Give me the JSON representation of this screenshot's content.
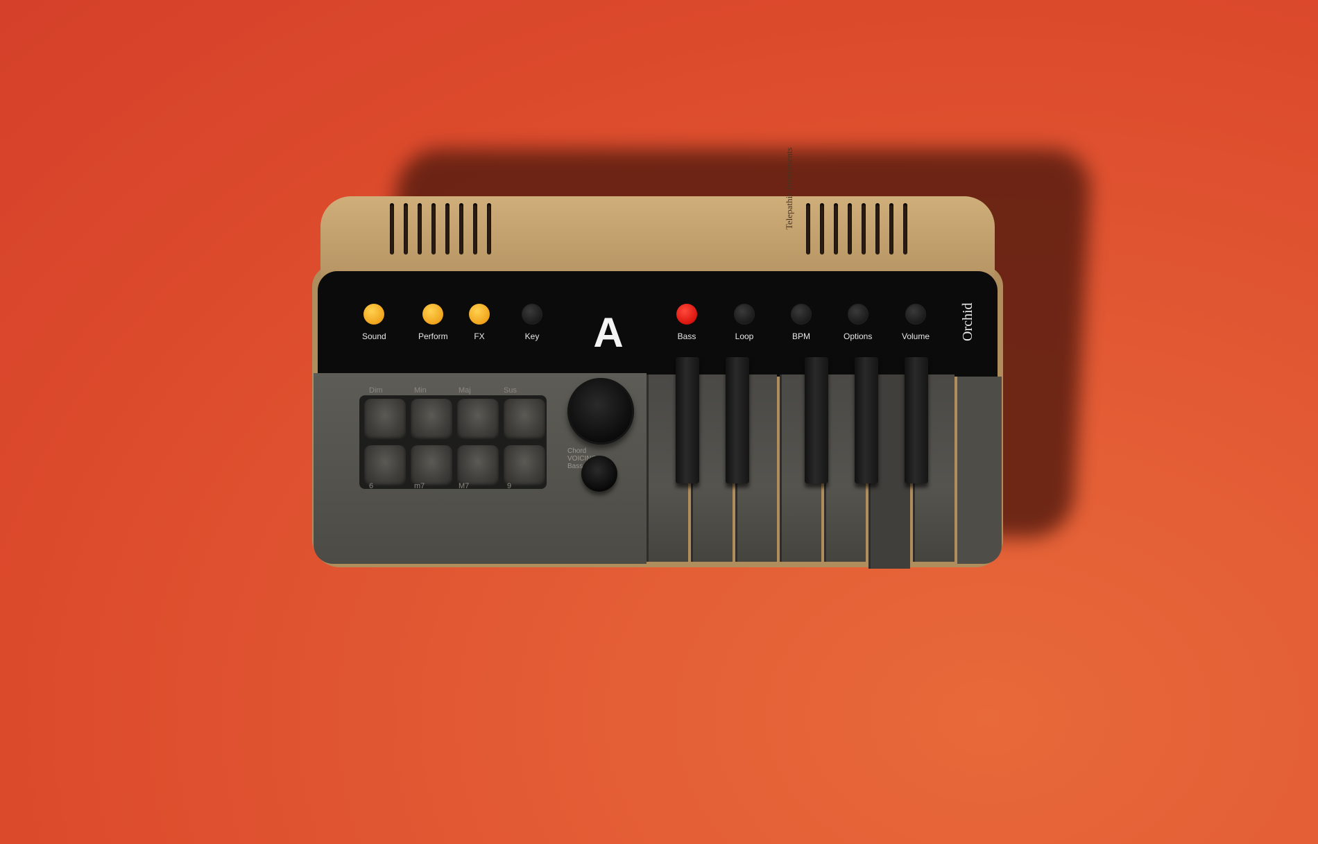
{
  "device": {
    "brand": "Telepathic Instruments",
    "model": "Orchid",
    "display_letter": "A"
  },
  "mode_buttons": [
    {
      "label": "Sound",
      "color": "#f0a41c"
    },
    {
      "label": "Perform",
      "color": "#f0a41c"
    },
    {
      "label": "FX",
      "color": "#f0a41c"
    },
    {
      "label": "Key",
      "color": "#1a1a1a"
    }
  ],
  "control_buttons": [
    {
      "label": "Bass",
      "color": "#d9140e"
    },
    {
      "label": "Loop",
      "color": "#1a1a1a"
    },
    {
      "label": "BPM",
      "color": "#1a1a1a"
    },
    {
      "label": "Options",
      "color": "#1a1a1a"
    },
    {
      "label": "Volume",
      "color": "#1a1a1a"
    }
  ],
  "chord_pads": {
    "top_labels": [
      "Dim",
      "Min",
      "Maj",
      "Sus"
    ],
    "bottom_labels": [
      "6",
      "m7",
      "M7",
      "9"
    ]
  },
  "knob_labels": {
    "line1": "Chord",
    "line2": "VOICING",
    "line3": "Bass"
  }
}
